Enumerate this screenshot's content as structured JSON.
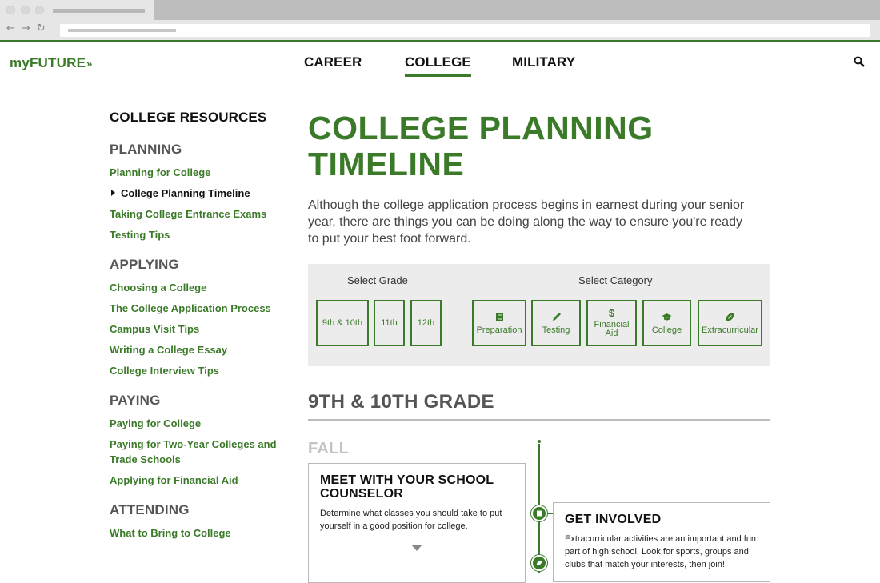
{
  "site": {
    "logo": "myFUTURE",
    "logo_mark": "»"
  },
  "topnav": {
    "career": "CAREER",
    "college": "COLLEGE",
    "military": "MILITARY"
  },
  "sidebar": {
    "title": "COLLEGE RESOURCES",
    "sections": [
      {
        "heading": "PLANNING",
        "links": [
          "Planning for College",
          "College Planning Timeline",
          "Taking College Entrance Exams",
          "Testing Tips"
        ]
      },
      {
        "heading": "APPLYING",
        "links": [
          "Choosing a College",
          "The College Application Process",
          "Campus Visit Tips",
          "Writing a College Essay",
          "College Interview Tips"
        ]
      },
      {
        "heading": "PAYING",
        "links": [
          "Paying for College",
          "Paying for Two-Year Colleges and Trade Schools",
          "Applying for Financial Aid"
        ]
      },
      {
        "heading": "ATTENDING",
        "links": [
          "What to Bring to College"
        ]
      }
    ]
  },
  "main": {
    "title": "COLLEGE PLANNING TIMELINE",
    "intro": "Although the college application process begins in earnest during your senior year, there are things you can be doing along the way to ensure you're ready to put your best foot forward.",
    "filters": {
      "grade_label": "Select Grade",
      "category_label": "Select Category",
      "grades": [
        "9th & 10th",
        "11th",
        "12th"
      ],
      "categories": [
        "Preparation",
        "Testing",
        "Financial Aid",
        "College",
        "Extracurricular"
      ]
    },
    "grade_heading": "9TH & 10TH GRADE",
    "season": "FALL",
    "cards": [
      {
        "title": "MEET WITH YOUR SCHOOL COUNSELOR",
        "body": "Determine what classes you should take to put yourself in a good position for college."
      },
      {
        "title": "GET INVOLVED",
        "body": "Extracurricular activities are an important and fun part of high school. Look for sports, groups and clubs that match your interests, then join!"
      }
    ]
  },
  "colors": {
    "accent": "#3a7a28",
    "chrome": "#e6e6e6",
    "filter_bg": "#ececec"
  }
}
